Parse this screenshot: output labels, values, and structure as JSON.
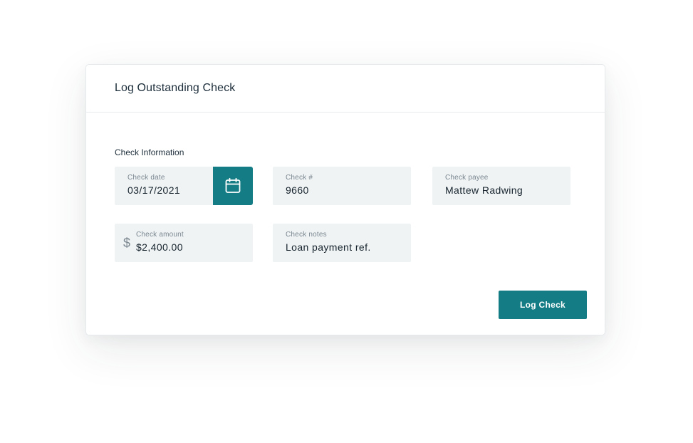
{
  "dialog": {
    "title": "Log Outstanding Check",
    "section_label": "Check Information"
  },
  "fields": {
    "check_date": {
      "label": "Check date",
      "value": "03/17/2021"
    },
    "check_number": {
      "label": "Check #",
      "value": "9660"
    },
    "check_payee": {
      "label": "Check payee",
      "value": "Mattew Radwing"
    },
    "check_amount": {
      "label": "Check amount",
      "currency_symbol": "$",
      "value": "$2,400.00"
    },
    "check_notes": {
      "label": "Check notes",
      "value": "Loan payment ref."
    }
  },
  "actions": {
    "submit_label": "Log Check"
  },
  "icons": {
    "calendar": "calendar-icon",
    "currency": "dollar-icon"
  },
  "colors": {
    "accent": "#147c84",
    "field_bg": "#eff3f4"
  }
}
